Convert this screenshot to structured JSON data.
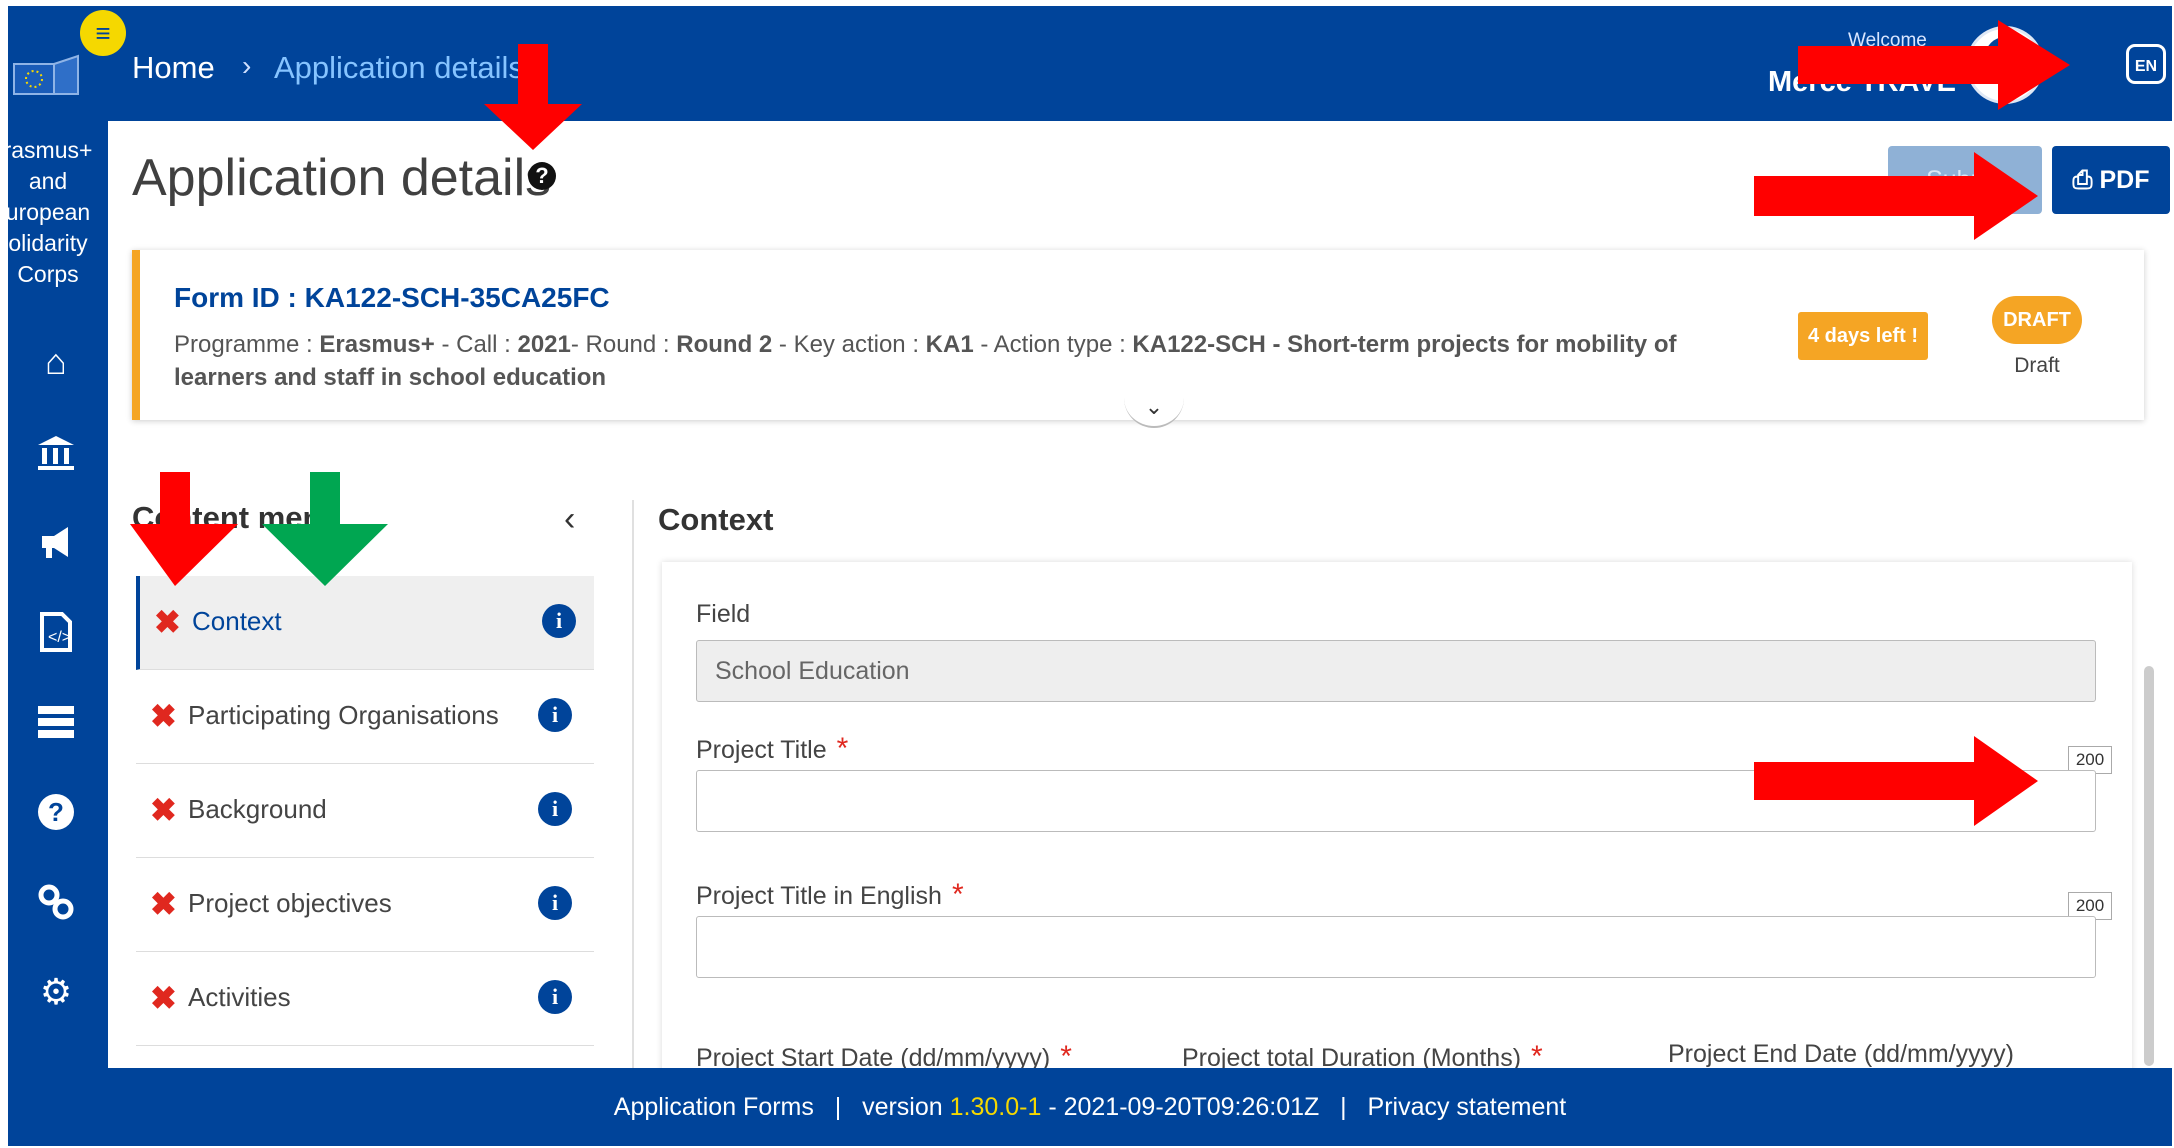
{
  "header": {
    "breadcrumb": {
      "home": "Home",
      "separator": "›",
      "current": "Application details"
    },
    "welcome": "Welcome",
    "user_name": "Merce TRAVE",
    "language": "EN"
  },
  "sidebar": {
    "org_label": "rasmus+ and uropean olidarity Corps",
    "icons": [
      "home-icon",
      "institution-icon",
      "megaphone-icon",
      "document-icon",
      "list-icon",
      "help-icon",
      "links-icon",
      "settings-icon"
    ]
  },
  "page": {
    "title": "Application details",
    "submit_label": "Submit",
    "pdf_label": "PDF"
  },
  "form_card": {
    "form_id": "Form ID : KA122-SCH-35CA25FC",
    "programme_label": "Programme : ",
    "programme": "Erasmus+",
    "call_label": " - Call : ",
    "call": "2021",
    "round_label": "- Round : ",
    "round": "Round 2",
    "key_action_label": " - Key action : ",
    "key_action": "KA1",
    "action_type_label": " - Action type : ",
    "action_type": "KA122-SCH - Short-term projects for mobility of learners and staff in school education",
    "deadline": "4 days left !",
    "status_badge": "DRAFT",
    "status_text": "Draft"
  },
  "content_menu": {
    "title": "Content menu",
    "items": [
      {
        "label": "Context"
      },
      {
        "label": "Participating Organisations"
      },
      {
        "label": "Background"
      },
      {
        "label": "Project objectives"
      },
      {
        "label": "Activities"
      }
    ]
  },
  "context": {
    "title": "Context",
    "field_label": "Field",
    "field_value": "School Education",
    "project_title_label": "Project Title",
    "project_title_limit": "200",
    "project_title_en_label": "Project Title in English",
    "project_title_en_limit": "200",
    "start_date_label": "Project Start Date (dd/mm/yyyy)",
    "duration_label": "Project total Duration (Months)",
    "end_date_label": "Project End Date (dd/mm/yyyy)",
    "required_mark": "*"
  },
  "footer": {
    "app_name": "Application Forms",
    "sep": "|",
    "version_label": "version",
    "version": "1.30.0-1",
    "build": "- 2021-09-20T09:26:01Z",
    "privacy": "Privacy statement"
  },
  "colors": {
    "brand": "#00449a",
    "accent": "#f5a524",
    "annotation_red": "#ff0000",
    "annotation_green": "#00a651"
  }
}
